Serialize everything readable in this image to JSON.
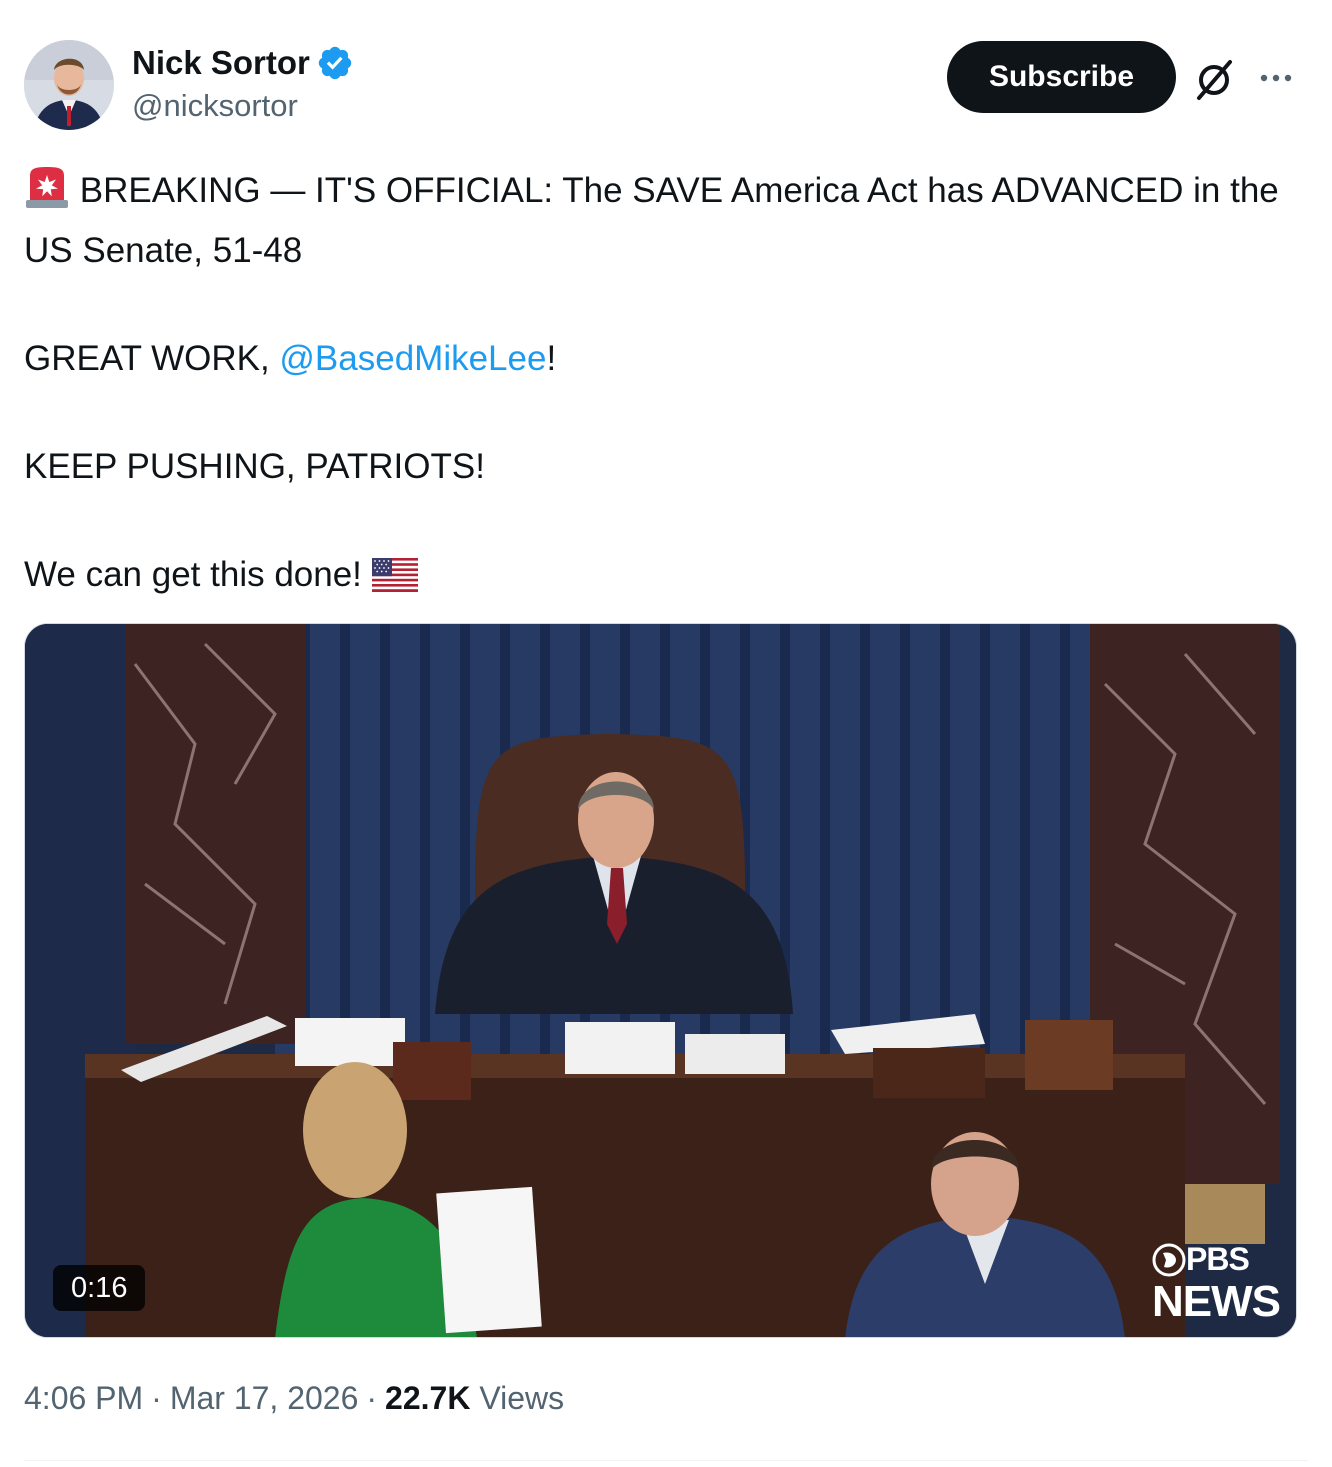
{
  "author": {
    "name": "Nick Sortor",
    "handle": "@nicksortor",
    "verified": true,
    "verified_color": "#1d9bf0",
    "avatar_icon": "profile-photo"
  },
  "actions": {
    "subscribe_label": "Subscribe",
    "grok_icon": "grok-slash-icon",
    "more_icon": "more-dots-icon"
  },
  "tweet": {
    "line1_emoji": "🚨",
    "line1_text": "BREAKING — IT'S OFFICIAL: The SAVE America Act has ADVANCED in the US Senate, 51-48",
    "line2_prefix": "GREAT WORK, ",
    "line2_mention": "@BasedMikeLee",
    "line2_suffix": "!",
    "line3_text": "KEEP PUSHING, PATRIOTS!",
    "line4_text": "We can get this done!",
    "line4_emoji": "🇺🇸",
    "mention_color": "#1d9bf0"
  },
  "media": {
    "duration": "0:16",
    "watermark_top": "PBS",
    "watermark_bottom": "NEWS"
  },
  "meta": {
    "time": "4:06 PM",
    "date": "Mar 17, 2026",
    "views_count": "22.7K",
    "views_label": "Views"
  }
}
